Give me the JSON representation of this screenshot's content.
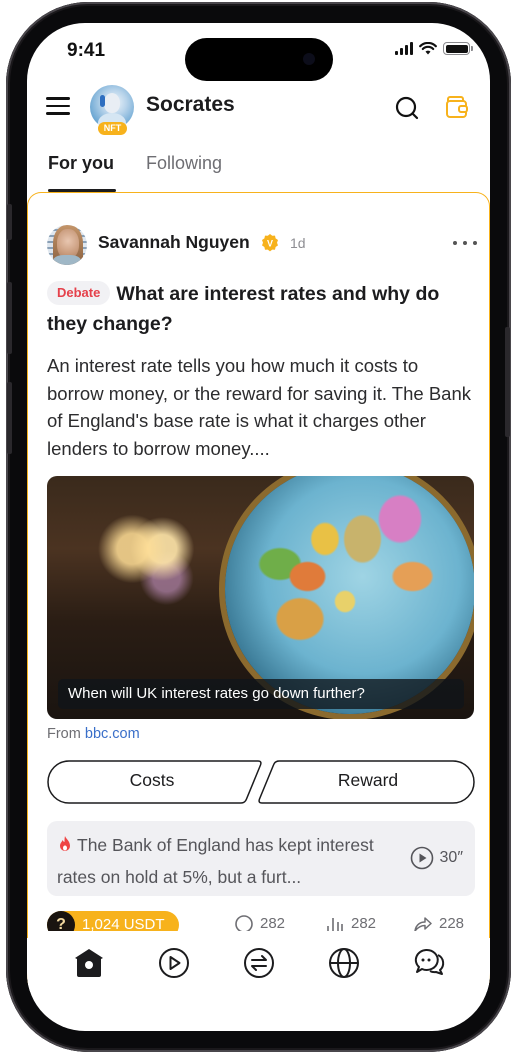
{
  "status_bar": {
    "time": "9:41",
    "icons": [
      "cellular-signal-icon",
      "wifi-icon",
      "battery-icon"
    ]
  },
  "header": {
    "app_title": "Socrates",
    "avatar_badge": "NFT",
    "icons": [
      "hamburger-menu-icon",
      "search-icon",
      "wallet-icon"
    ],
    "accent_color": "#f7b21c"
  },
  "tabs": [
    {
      "label": "For you",
      "active": true
    },
    {
      "label": "Following",
      "active": false
    }
  ],
  "post": {
    "author": "Savannah Nguyen",
    "verified_badge": "V",
    "time": "1d",
    "tag": "Debate",
    "tag_color": "#e5414b",
    "title": "What are interest rates and why do they change?",
    "body": "An interest rate tells you how much it costs to borrow money, or the reward for saving it. The Bank of England's base rate is what it charges other lenders to borrow money....",
    "media_caption": "When will UK interest rates go down further?",
    "source_prefix": "From",
    "source_link": "bbc.com",
    "vote_options": [
      "Costs",
      "Reward"
    ],
    "summary": {
      "text": "The Bank of England has kept interest rates on hold at 5%, but a furt...",
      "audio_duration": "30″"
    },
    "reward": "1,024 USDT",
    "reward_icon": "?",
    "stats": {
      "comments": "282",
      "views": "282",
      "shares": "228"
    }
  },
  "tabbar": {
    "items": [
      {
        "name": "home",
        "icon": "home-icon",
        "active": true
      },
      {
        "name": "video",
        "icon": "play-circle-icon",
        "active": false
      },
      {
        "name": "exchange",
        "icon": "swap-icon",
        "active": false
      },
      {
        "name": "explore",
        "icon": "globe-icon",
        "active": false
      },
      {
        "name": "messages",
        "icon": "chat-bubbles-icon",
        "active": false
      }
    ]
  }
}
